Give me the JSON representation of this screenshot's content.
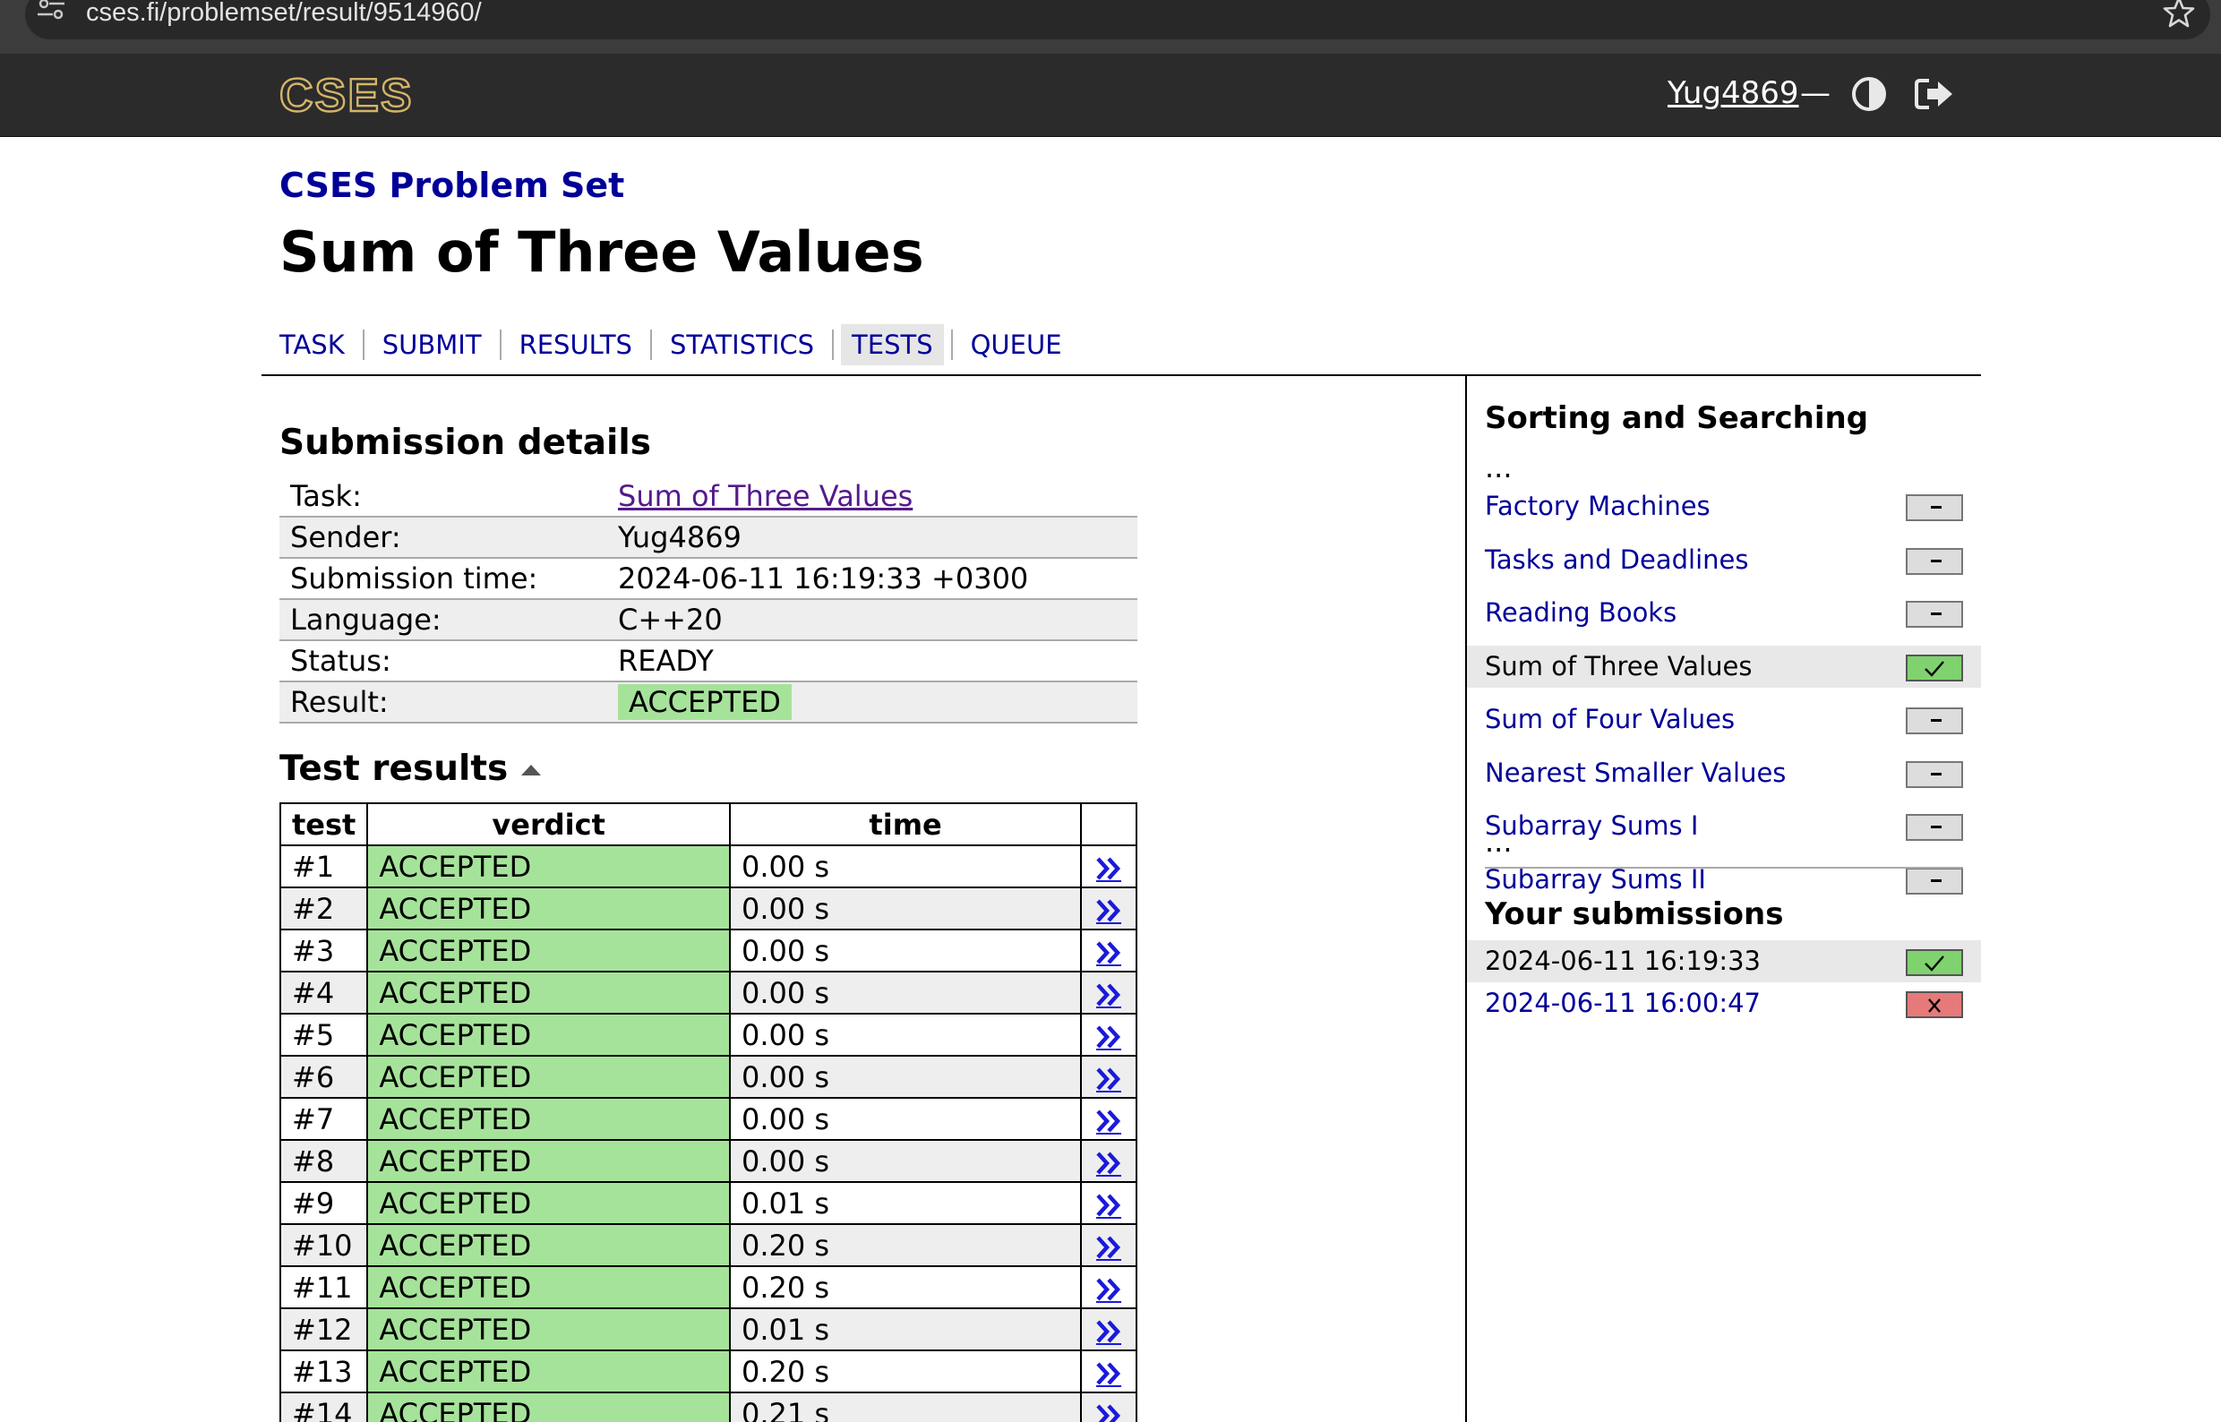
{
  "browser": {
    "url": "cses.fi/problemset/result/9514960/"
  },
  "header": {
    "logo": "CSES",
    "username": "Yug4869",
    "separator": "—"
  },
  "breadcrumb": "CSES Problem Set",
  "page_title": "Sum of Three Values",
  "nav": {
    "items": [
      "TASK",
      "SUBMIT",
      "RESULTS",
      "STATISTICS",
      "TESTS",
      "QUEUE"
    ],
    "current": "TESTS"
  },
  "submission": {
    "heading": "Submission details",
    "rows": [
      {
        "key": "Task:",
        "value": "Sum of Three Values"
      },
      {
        "key": "Sender:",
        "value": "Yug4869"
      },
      {
        "key": "Submission time:",
        "value": "2024-06-11 16:19:33 +0300"
      },
      {
        "key": "Language:",
        "value": "C++20"
      },
      {
        "key": "Status:",
        "value": "READY"
      },
      {
        "key": "Result:",
        "value": "ACCEPTED"
      }
    ]
  },
  "tests": {
    "heading": "Test results",
    "columns": [
      "test",
      "verdict",
      "time"
    ],
    "rows": [
      {
        "test": "#1",
        "verdict": "ACCEPTED",
        "time": "0.00 s"
      },
      {
        "test": "#2",
        "verdict": "ACCEPTED",
        "time": "0.00 s"
      },
      {
        "test": "#3",
        "verdict": "ACCEPTED",
        "time": "0.00 s"
      },
      {
        "test": "#4",
        "verdict": "ACCEPTED",
        "time": "0.00 s"
      },
      {
        "test": "#5",
        "verdict": "ACCEPTED",
        "time": "0.00 s"
      },
      {
        "test": "#6",
        "verdict": "ACCEPTED",
        "time": "0.00 s"
      },
      {
        "test": "#7",
        "verdict": "ACCEPTED",
        "time": "0.00 s"
      },
      {
        "test": "#8",
        "verdict": "ACCEPTED",
        "time": "0.00 s"
      },
      {
        "test": "#9",
        "verdict": "ACCEPTED",
        "time": "0.01 s"
      },
      {
        "test": "#10",
        "verdict": "ACCEPTED",
        "time": "0.20 s"
      },
      {
        "test": "#11",
        "verdict": "ACCEPTED",
        "time": "0.20 s"
      },
      {
        "test": "#12",
        "verdict": "ACCEPTED",
        "time": "0.01 s"
      },
      {
        "test": "#13",
        "verdict": "ACCEPTED",
        "time": "0.20 s"
      },
      {
        "test": "#14",
        "verdict": "ACCEPTED",
        "time": "0.21 s"
      }
    ]
  },
  "sidebar": {
    "section_title": "Sorting and Searching",
    "ellipsis": "...",
    "tasks": [
      {
        "label": "Factory Machines",
        "status": "none"
      },
      {
        "label": "Tasks and Deadlines",
        "status": "none"
      },
      {
        "label": "Reading Books",
        "status": "none"
      },
      {
        "label": "Sum of Three Values",
        "status": "solved",
        "current": true
      },
      {
        "label": "Sum of Four Values",
        "status": "none"
      },
      {
        "label": "Nearest Smaller Values",
        "status": "none"
      },
      {
        "label": "Subarray Sums I",
        "status": "none"
      },
      {
        "label": "Subarray Sums II",
        "status": "none"
      }
    ],
    "submissions_title": "Your submissions",
    "submissions": [
      {
        "time": "2024-06-11 16:19:33",
        "status": "accepted",
        "current": true
      },
      {
        "time": "2024-06-11 16:00:47",
        "status": "rejected"
      }
    ]
  },
  "colors": {
    "accepted_green": "#a6e39a",
    "link_blue": "#000099",
    "header_bg": "#2b2b2b"
  }
}
